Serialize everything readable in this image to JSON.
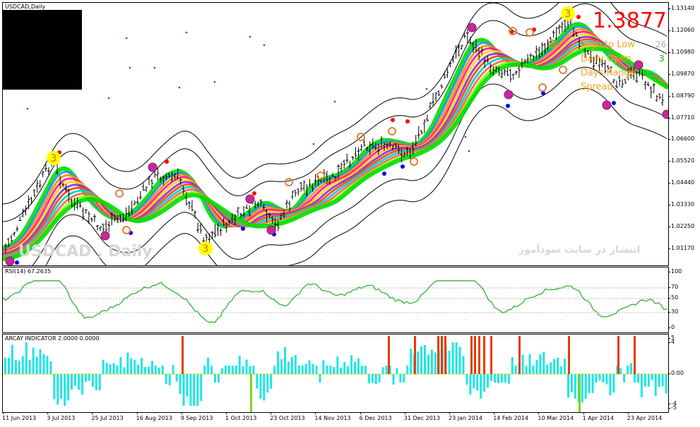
{
  "main": {
    "title": "USDCAD,Daily",
    "price_big": "1.3877",
    "info_lines": [
      "High to Low",
      "Daily Open",
      "Days Range",
      "Spread"
    ],
    "info_values": [
      "26",
      "3"
    ],
    "watermark": "USDCAD , Daily",
    "persian_text": "انتشار در سایت سودآموز",
    "yaxis": [
      "1.13140",
      "1.12060",
      "1.10980",
      "1.09870",
      "1.08790",
      "1.07710",
      "1.06600",
      "1.05520",
      "1.04440",
      "1.03330",
      "1.02250",
      "1.01170"
    ],
    "marker_labels": [
      "3",
      "3",
      "3"
    ]
  },
  "rsi": {
    "title": "RSI(14) 67.2635",
    "yaxis": [
      "100",
      "70",
      "50",
      "30",
      "0"
    ]
  },
  "arcay": {
    "title": "ARCAY INDICATOR 2.0000 0.0000",
    "yaxis": [
      "5",
      "4",
      "0.00",
      "-4",
      "-5"
    ]
  },
  "xaxis": [
    "11 Jun 2013",
    "3 Jul 2013",
    "25 Jul 2013",
    "16 Aug 2013",
    "9 Sep 2013",
    "1 Oct 2013",
    "23 Oct 2013",
    "14 Nov 2013",
    "6 Dec 2013",
    "31 Dec 2013",
    "23 Jan 2014",
    "14 Feb 2014",
    "10 Mar 2014",
    "1 Apr 2014",
    "23 Apr 2014"
  ],
  "colors": {
    "up_bar": "#1ee6e6",
    "down_bar": "#e63c00",
    "rsi_line": "#32b432",
    "ribbon_outer": "#00dd00",
    "price_red": "#ff0000",
    "label_orange": "#f5a623"
  }
}
